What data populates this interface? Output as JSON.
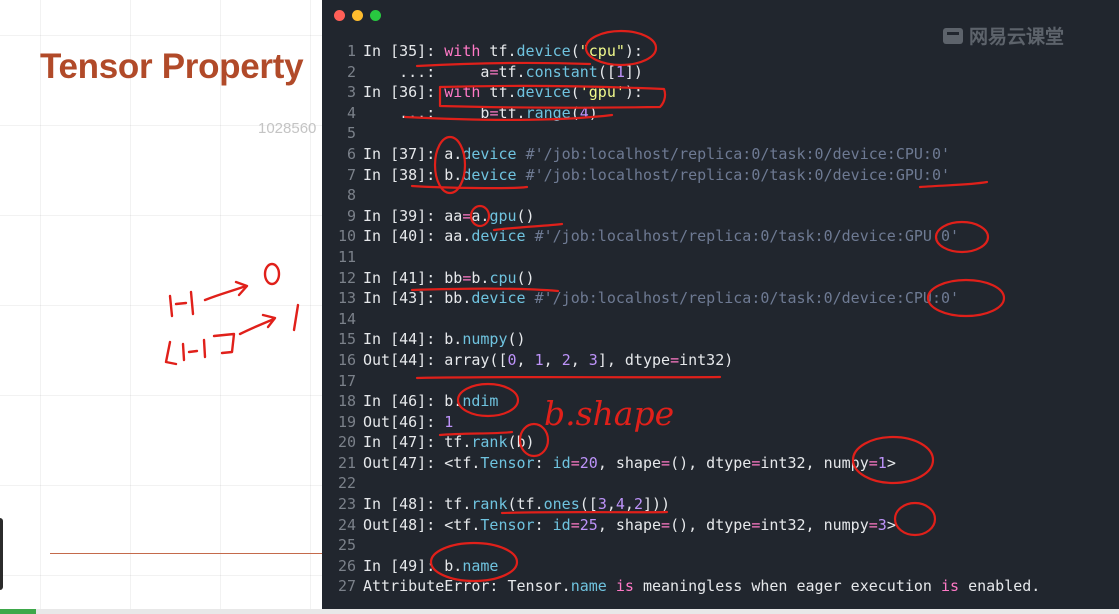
{
  "slide": {
    "title": "Tensor Property",
    "number": "1028560",
    "handwriting": [
      "1-1 → 0",
      "[1-1] → 1"
    ]
  },
  "terminal": {
    "watermark": "网易云课堂",
    "lines": [
      {
        "n": "1",
        "segs": [
          [
            "t",
            "In [35]: "
          ],
          [
            "kw",
            "with"
          ],
          [
            "t",
            " tf."
          ],
          [
            "fn",
            "device"
          ],
          [
            "t",
            "("
          ],
          [
            "str",
            "\"cpu\""
          ],
          [
            "t",
            "):"
          ]
        ]
      },
      {
        "n": "2",
        "segs": [
          [
            "t",
            "    ...:     a"
          ],
          [
            "kw",
            "="
          ],
          [
            "t",
            "tf."
          ],
          [
            "fn",
            "constant"
          ],
          [
            "t",
            "(["
          ],
          [
            "num",
            "1"
          ],
          [
            "t",
            "])"
          ]
        ]
      },
      {
        "n": "3",
        "segs": [
          [
            "t",
            "In [36]: "
          ],
          [
            "kw",
            "with"
          ],
          [
            "t",
            " tf."
          ],
          [
            "fn",
            "device"
          ],
          [
            "t",
            "("
          ],
          [
            "str",
            "'gpu'"
          ],
          [
            "t",
            "):"
          ]
        ]
      },
      {
        "n": "4",
        "segs": [
          [
            "t",
            "    ...:     b"
          ],
          [
            "kw",
            "="
          ],
          [
            "t",
            "tf."
          ],
          [
            "fn",
            "range"
          ],
          [
            "t",
            "("
          ],
          [
            "num",
            "4"
          ],
          [
            "t",
            ")"
          ]
        ]
      },
      {
        "n": "5",
        "segs": []
      },
      {
        "n": "6",
        "segs": [
          [
            "t",
            "In [37]: a."
          ],
          [
            "fn",
            "device"
          ],
          [
            "t",
            " "
          ],
          [
            "cm",
            "#'/job:localhost/replica:0/task:0/device:CPU:0'"
          ]
        ]
      },
      {
        "n": "7",
        "segs": [
          [
            "t",
            "In [38]: b."
          ],
          [
            "fn",
            "device"
          ],
          [
            "t",
            " "
          ],
          [
            "cm",
            "#'/job:localhost/replica:0/task:0/device:GPU:0'"
          ]
        ]
      },
      {
        "n": "8",
        "segs": []
      },
      {
        "n": "9",
        "segs": [
          [
            "t",
            "In [39]: aa"
          ],
          [
            "kw",
            "="
          ],
          [
            "t",
            "a."
          ],
          [
            "fn",
            "gpu"
          ],
          [
            "t",
            "()"
          ]
        ]
      },
      {
        "n": "10",
        "segs": [
          [
            "t",
            "In [40]: aa."
          ],
          [
            "fn",
            "device"
          ],
          [
            "t",
            " "
          ],
          [
            "cm",
            "#'/job:localhost/replica:0/task:0/device:GPU:0'"
          ]
        ]
      },
      {
        "n": "11",
        "segs": []
      },
      {
        "n": "12",
        "segs": [
          [
            "t",
            "In [41]: bb"
          ],
          [
            "kw",
            "="
          ],
          [
            "t",
            "b."
          ],
          [
            "fn",
            "cpu"
          ],
          [
            "t",
            "()"
          ]
        ]
      },
      {
        "n": "13",
        "segs": [
          [
            "t",
            "In [43]: bb."
          ],
          [
            "fn",
            "device"
          ],
          [
            "t",
            " "
          ],
          [
            "cm",
            "#'/job:localhost/replica:0/task:0/device:CPU:0'"
          ]
        ]
      },
      {
        "n": "14",
        "segs": []
      },
      {
        "n": "15",
        "segs": [
          [
            "t",
            "In [44]: b."
          ],
          [
            "fn",
            "numpy"
          ],
          [
            "t",
            "()"
          ]
        ]
      },
      {
        "n": "16",
        "segs": [
          [
            "t",
            "Out[44]: array(["
          ],
          [
            "num",
            "0"
          ],
          [
            "t",
            ", "
          ],
          [
            "num",
            "1"
          ],
          [
            "t",
            ", "
          ],
          [
            "num",
            "2"
          ],
          [
            "t",
            ", "
          ],
          [
            "num",
            "3"
          ],
          [
            "t",
            "], dtype"
          ],
          [
            "kw",
            "="
          ],
          [
            "t",
            "int32)"
          ]
        ]
      },
      {
        "n": "17",
        "segs": []
      },
      {
        "n": "18",
        "segs": [
          [
            "t",
            "In [46]: b."
          ],
          [
            "fn",
            "ndim"
          ]
        ]
      },
      {
        "n": "19",
        "segs": [
          [
            "t",
            "Out[46]: "
          ],
          [
            "num",
            "1"
          ]
        ]
      },
      {
        "n": "20",
        "segs": [
          [
            "t",
            "In [47]: tf."
          ],
          [
            "fn",
            "rank"
          ],
          [
            "t",
            "(b)"
          ]
        ]
      },
      {
        "n": "21",
        "segs": [
          [
            "t",
            "Out[47]: <tf."
          ],
          [
            "fn",
            "Tensor"
          ],
          [
            "t",
            ": "
          ],
          [
            "fn",
            "id"
          ],
          [
            "kw",
            "="
          ],
          [
            "num",
            "20"
          ],
          [
            "t",
            ", shape"
          ],
          [
            "kw",
            "="
          ],
          [
            "t",
            "(), dtype"
          ],
          [
            "kw",
            "="
          ],
          [
            "t",
            "int32, numpy"
          ],
          [
            "kw",
            "="
          ],
          [
            "num",
            "1"
          ],
          [
            "t",
            ">"
          ]
        ]
      },
      {
        "n": "22",
        "segs": []
      },
      {
        "n": "23",
        "segs": [
          [
            "t",
            "In [48]: tf."
          ],
          [
            "fn",
            "rank"
          ],
          [
            "t",
            "(tf."
          ],
          [
            "fn",
            "ones"
          ],
          [
            "t",
            "(["
          ],
          [
            "num",
            "3"
          ],
          [
            "t",
            ","
          ],
          [
            "num",
            "4"
          ],
          [
            "t",
            ","
          ],
          [
            "num",
            "2"
          ],
          [
            "t",
            "]))"
          ]
        ]
      },
      {
        "n": "24",
        "segs": [
          [
            "t",
            "Out[48]: <tf."
          ],
          [
            "fn",
            "Tensor"
          ],
          [
            "t",
            ": "
          ],
          [
            "fn",
            "id"
          ],
          [
            "kw",
            "="
          ],
          [
            "num",
            "25"
          ],
          [
            "t",
            ", shape"
          ],
          [
            "kw",
            "="
          ],
          [
            "t",
            "(), dtype"
          ],
          [
            "kw",
            "="
          ],
          [
            "t",
            "int32, numpy"
          ],
          [
            "kw",
            "="
          ],
          [
            "num",
            "3"
          ],
          [
            "t",
            ">"
          ]
        ]
      },
      {
        "n": "25",
        "segs": []
      },
      {
        "n": "26",
        "segs": [
          [
            "t",
            "In [49]: b."
          ],
          [
            "fn",
            "name"
          ]
        ]
      },
      {
        "n": "27",
        "segs": [
          [
            "t",
            "AttributeError: Tensor."
          ],
          [
            "fn",
            "name"
          ],
          [
            "t",
            " "
          ],
          [
            "kw",
            "is"
          ],
          [
            "t",
            " meaningless when eager execution "
          ],
          [
            "kw",
            "is"
          ],
          [
            "t",
            " enabled."
          ]
        ]
      }
    ],
    "annotation_text": "b.shape",
    "annotation_color": "#e0201a"
  }
}
